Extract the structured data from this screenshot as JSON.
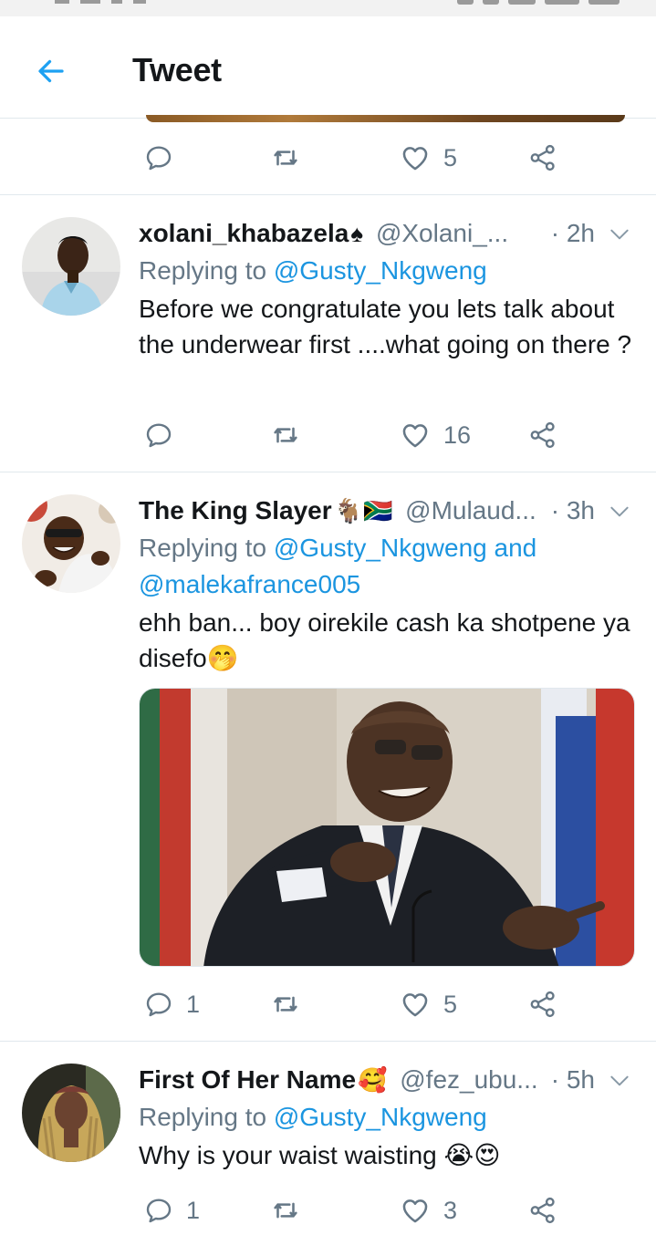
{
  "appbar": {
    "title": "Tweet",
    "back_icon": "arrow-left-icon",
    "accent": "#1da1f2"
  },
  "colors": {
    "mention": "#1b95e0",
    "secondary_text": "#657786",
    "divider": "#e1e8ed"
  },
  "previous_tweet_actions": {
    "reply_count": "",
    "retweet_count": "",
    "like_count": "5"
  },
  "tweets": [
    {
      "name": "xolani_khabazela",
      "name_emoji": "♠",
      "handle": "@Xolani_...",
      "time": "· 2h",
      "replying_prefix": "Replying to ",
      "replying_to": "@Gusty_Nkgweng",
      "replying_conj": "",
      "replying_to_2": "",
      "body": "Before we congratulate you lets talk about the underwear first ....what going on there ?",
      "reply_count": "",
      "retweet_count": "",
      "like_count": "16"
    },
    {
      "name": "The King Slayer",
      "name_emoji": "🐐🇿🇦",
      "handle": "@Mulaud...",
      "time": "· 3h",
      "replying_prefix": "Replying to ",
      "replying_to": "@Gusty_Nkgweng",
      "replying_conj": " and",
      "replying_to_2": "@malekafrance005",
      "body": "ehh ban... boy oirekile cash ka shotpene ya disefo🤭",
      "has_media": true,
      "reply_count": "1",
      "retweet_count": "",
      "like_count": "5"
    },
    {
      "name": "First Of Her Name",
      "name_emoji": "🥰",
      "handle": "@fez_ubu...",
      "time": "· 5h",
      "replying_prefix": "Replying to ",
      "replying_to": "@Gusty_Nkgweng",
      "replying_conj": "",
      "replying_to_2": "",
      "body": "Why is your waist waisting 😭😍",
      "reply_count": "1",
      "retweet_count": "",
      "like_count": "3"
    }
  ]
}
